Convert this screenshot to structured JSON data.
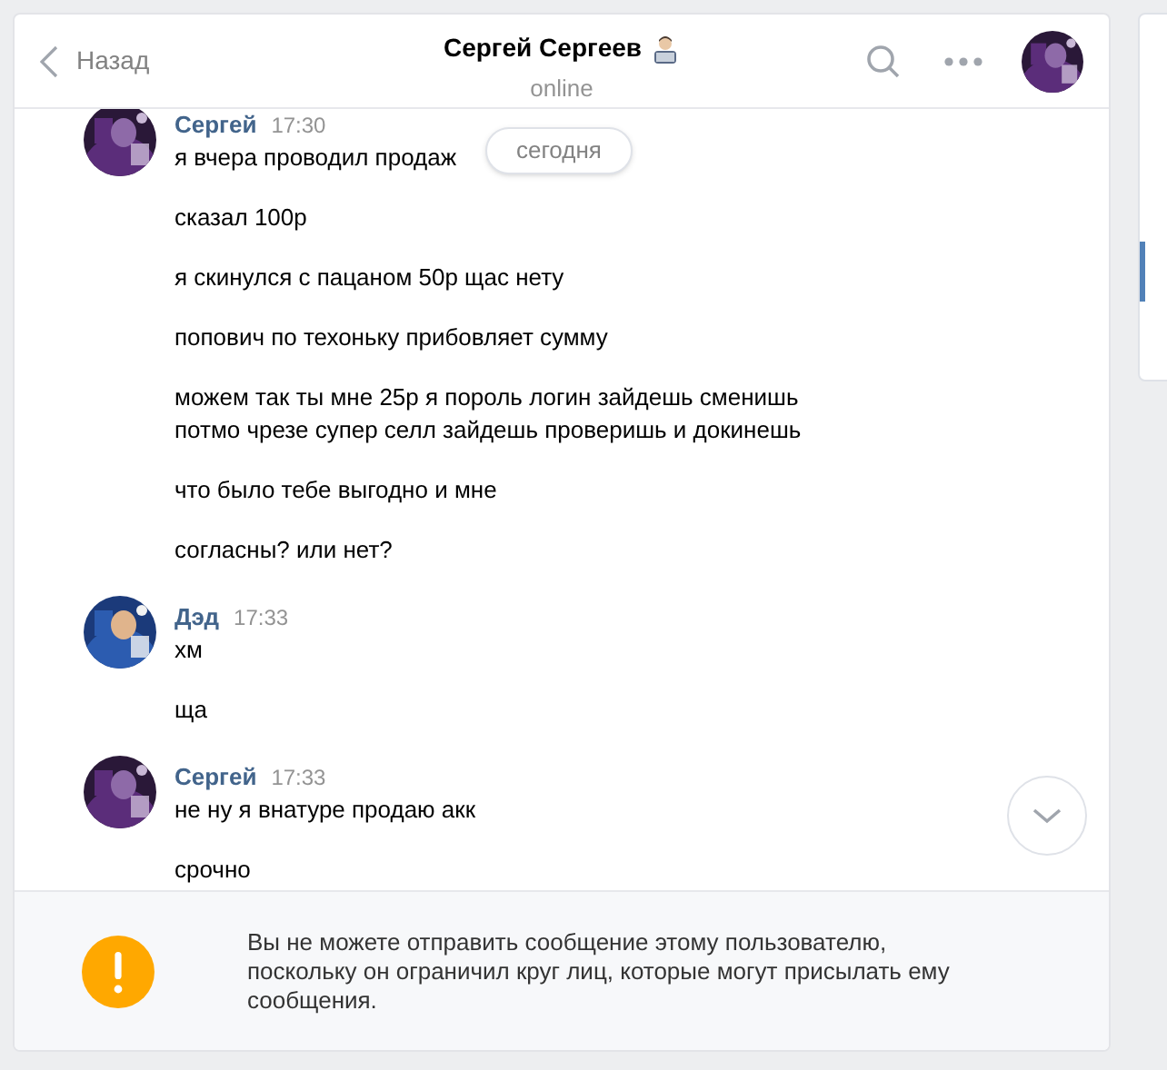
{
  "header": {
    "back_label": "Назад",
    "title": "Сергей Сергеев",
    "status": "online"
  },
  "date_pill": "сегодня",
  "groups": [
    {
      "author": "Сергей",
      "time": "17:30",
      "messages": [
        "я вчера проводил продаж",
        "сказал 100р",
        "я скинулся с пацаном 50р щас нету",
        "попович по техоньку прибовляет сумму",
        "можем так ты мне 25р я пороль логин зайдешь сменишь\nпотмо чрезе супер селл зайдешь проверишь и докинешь",
        "что было тебе выгодно и мне",
        "согласны? или нет?"
      ]
    },
    {
      "author": "Дэд",
      "time": "17:33",
      "messages": [
        "хм",
        "ща"
      ]
    },
    {
      "author": "Сергей",
      "time": "17:33",
      "messages": [
        "не ну я внатуре продаю акк",
        "срочно"
      ]
    }
  ],
  "notice": "Вы не можете отправить сообщение этому пользователю, поскольку он ограничил круг лиц, которые могут присылать ему сообщения."
}
